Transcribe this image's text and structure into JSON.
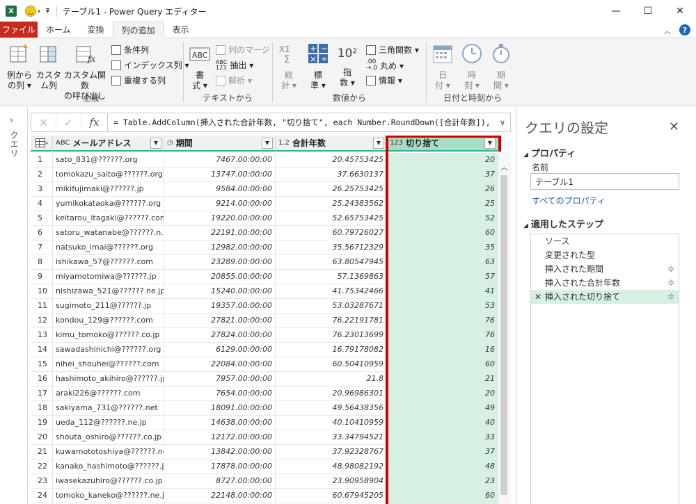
{
  "titlebar": {
    "app_icon": "X",
    "title": "テーブル1 - Power Query エディター",
    "minimize": "—",
    "maximize": "☐",
    "close": "✕"
  },
  "tabs": [
    {
      "label": "ファイル"
    },
    {
      "label": "ホーム"
    },
    {
      "label": "変換"
    },
    {
      "label": "列の追加"
    },
    {
      "label": "表示"
    }
  ],
  "ribbon": {
    "general": {
      "label": "全般",
      "example_col": "例から\nの列 ▾",
      "custom_col": "カスタ\nム列",
      "invoke_fn": "カスタム関数\nの呼び出し",
      "conditional": "条件列",
      "index": "インデックス列 ▾",
      "duplicate": "重複する列"
    },
    "text": {
      "label": "テキストから",
      "format": "書\n式 ▾",
      "merge": "列のマージ",
      "extract": "抽出 ▾",
      "parse": "解析 ▾"
    },
    "number": {
      "label": "数値から",
      "stats": "統\n計 ▾",
      "standard": "標\n準 ▾",
      "sci": "指\n数 ▾",
      "trig": "三角関数 ▾",
      "round": "丸め ▾",
      "info": "情報 ▾",
      "sci_icon": "10²"
    },
    "datetime": {
      "label": "日付と時刻から",
      "date": "日\n付 ▾",
      "time": "時\n刻 ▾",
      "duration": "期\n間 ▾"
    }
  },
  "left_panel": {
    "label": "クエリ",
    "chevron": "›"
  },
  "formula": {
    "cancel": "✕",
    "commit": "✓",
    "fx": "fx",
    "text": "= Table.AddColumn(挿入された合計年数, \"切り捨て\", each Number.RoundDown([合計年数]), ",
    "expand": "∨"
  },
  "grid": {
    "columns": [
      {
        "type_icon": "ABC",
        "name": "メールアドレス"
      },
      {
        "type_icon": "◷",
        "name": "期間"
      },
      {
        "type_icon": "1.2",
        "name": "合計年数"
      },
      {
        "type_icon": "123",
        "name": "切り捨て"
      }
    ],
    "rows": [
      [
        "1",
        "sato_831@??????.org",
        "7467.00:00:00",
        "20.45753425",
        "20"
      ],
      [
        "2",
        "tomokazu_saito@??????.org",
        "13747.00:00:00",
        "37.6630137",
        "37"
      ],
      [
        "3",
        "mikifujimaki@??????.jp",
        "9584.00:00:00",
        "26.25753425",
        "26"
      ],
      [
        "4",
        "yumikokataoka@??????.org",
        "9214.00:00:00",
        "25.24383562",
        "25"
      ],
      [
        "5",
        "keitarou_itagaki@??????.com",
        "19220.00:00:00",
        "52.65753425",
        "52"
      ],
      [
        "6",
        "satoru_watanabe@??????.n...",
        "22191.00:00:00",
        "60.79726027",
        "60"
      ],
      [
        "7",
        "natsuko_imai@??????.org",
        "12982.00:00:00",
        "35.56712329",
        "35"
      ],
      [
        "8",
        "ishikawa_57@??????.com",
        "23289.00:00:00",
        "63.80547945",
        "63"
      ],
      [
        "9",
        "miyamotomiwa@??????.jp",
        "20855.00:00:00",
        "57.1369863",
        "57"
      ],
      [
        "10",
        "nishizawa_521@??????.ne.jp",
        "15240.00:00:00",
        "41.75342466",
        "41"
      ],
      [
        "11",
        "sugimoto_211@??????.jp",
        "19357.00:00:00",
        "53.03287671",
        "53"
      ],
      [
        "12",
        "kondou_129@??????.com",
        "27821.00:00:00",
        "76.22191781",
        "76"
      ],
      [
        "13",
        "kimu_tomoko@??????.co.jp",
        "27824.00:00:00",
        "76.23013699",
        "76"
      ],
      [
        "14",
        "sawadashinichi@??????.org",
        "6129.00:00:00",
        "16.79178082",
        "16"
      ],
      [
        "15",
        "nihei_shouhei@??????.com",
        "22084.00:00:00",
        "60.50410959",
        "60"
      ],
      [
        "16",
        "hashimoto_akihiro@??????.jp",
        "7957.00:00:00",
        "21.8",
        "21"
      ],
      [
        "17",
        "araki226@??????.com",
        "7654.00:00:00",
        "20.96986301",
        "20"
      ],
      [
        "18",
        "sakiyama_731@??????.net",
        "18091.00:00:00",
        "49.56438356",
        "49"
      ],
      [
        "19",
        "ueda_112@??????.ne.jp",
        "14638.00:00:00",
        "40.10410959",
        "40"
      ],
      [
        "20",
        "shouta_oshiro@??????.co.jp",
        "12172.00:00:00",
        "33.34794521",
        "33"
      ],
      [
        "21",
        "kuwamototoshiya@??????.net",
        "13842.00:00:00",
        "37.92328767",
        "37"
      ],
      [
        "22",
        "kanako_hashimoto@??????.jp",
        "17878.00:00:00",
        "48.98082192",
        "48"
      ],
      [
        "23",
        "iwasekazuhiro@??????.co.jp",
        "8727.00:00:00",
        "23.90958904",
        "23"
      ],
      [
        "24",
        "tomoko_kaneko@??????.ne.jp",
        "22148.00:00:00",
        "60.67945205",
        "60"
      ],
      [
        "25",
        "",
        "",
        "",
        ""
      ]
    ]
  },
  "settings": {
    "title": "クエリの設定",
    "close": "✕",
    "properties": "プロパティ",
    "name_label": "名前",
    "name_value": "テーブル1",
    "all_props": "すべてのプロパティ",
    "applied_steps": "適用したステップ",
    "steps": [
      {
        "label": "ソース",
        "gear": false
      },
      {
        "label": "変更された型",
        "gear": false
      },
      {
        "label": "挿入された期間",
        "gear": true
      },
      {
        "label": "挿入された合計年数",
        "gear": true
      },
      {
        "label": "挿入された切り捨て",
        "gear": true,
        "active": true
      }
    ]
  },
  "colors": {
    "accent_green": "#2eb0a0",
    "selected_fill": "#d6f0e2",
    "highlight_red": "#d00000",
    "file_tab": "#c42b1c"
  }
}
